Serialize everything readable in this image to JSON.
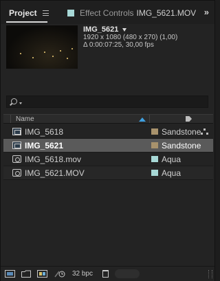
{
  "tabs": {
    "project_label": "Project",
    "effects_label": "Effect Controls",
    "effects_target": "IMG_5621.MOV",
    "effects_swatch": "#a7d8d6",
    "overflow_glyph": "»"
  },
  "preview": {
    "title": "IMG_5621",
    "resolution": "1920 x 1080  (480 x 270) (1,00)",
    "duration": "Δ 0:00:07:25, 30,00 fps"
  },
  "search": {
    "placeholder": ""
  },
  "columns": {
    "name": "Name"
  },
  "items": [
    {
      "name": "IMG_5618",
      "type": "composition",
      "label": "Sandstone",
      "label_color": "#a8926c",
      "selected": false
    },
    {
      "name": "IMG_5621",
      "type": "composition",
      "label": "Sandstone",
      "label_color": "#a8926c",
      "selected": true
    },
    {
      "name": "IMG_5618.mov",
      "type": "footage",
      "label": "Aqua",
      "label_color": "#a7d8d6",
      "selected": false
    },
    {
      "name": "IMG_5621.MOV",
      "type": "footage",
      "label": "Aqua",
      "label_color": "#a7d8d6",
      "selected": false
    }
  ],
  "toolbar": {
    "bpc": "32 bpc"
  },
  "colors": {
    "accent": "#3fa0e0",
    "selection": "#5a5a5a"
  }
}
